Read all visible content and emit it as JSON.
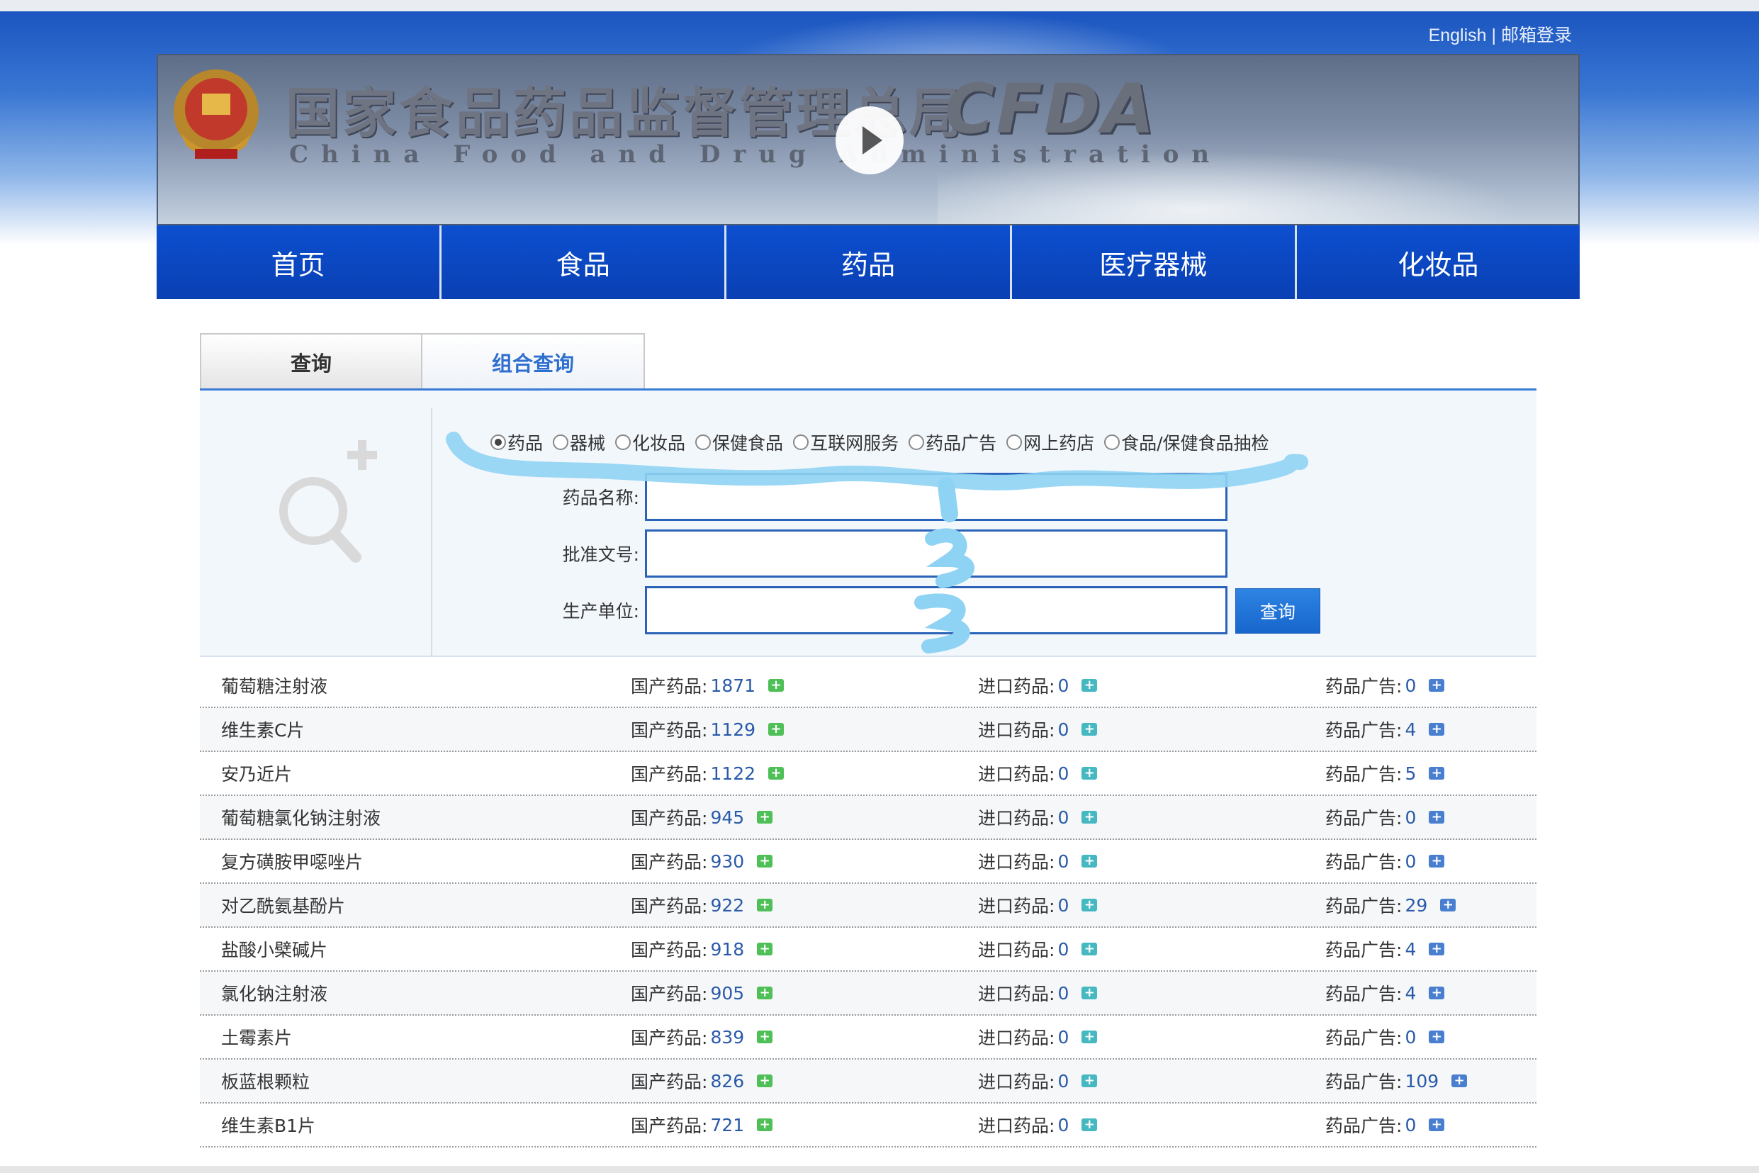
{
  "header": {
    "link_english": "English",
    "link_separator": "|",
    "link_mail": "邮箱登录",
    "banner_title_cn": "国家食品药品监督管理总局",
    "banner_title_en": "China Food and Drug Administration",
    "banner_logo": "CFDA"
  },
  "nav": {
    "items": [
      "首页",
      "食品",
      "药品",
      "医疗器械",
      "化妆品"
    ]
  },
  "tabs": {
    "query": "查询",
    "combined": "组合查询"
  },
  "search": {
    "categories": [
      "药品",
      "器械",
      "化妆品",
      "保健食品",
      "互联网服务",
      "药品广告",
      "网上药店",
      "食品/保健食品抽检"
    ],
    "selected_category": "药品",
    "field_name_label": "药品名称:",
    "field_approval_label": "批准文号:",
    "field_maker_label": "生产单位:",
    "field_name_value": "",
    "field_approval_value": "",
    "field_maker_value": "",
    "submit_label": "查询"
  },
  "results": {
    "domestic_label": "国产药品:",
    "import_label": "进口药品:",
    "ad_label": "药品广告:",
    "rows": [
      {
        "name": "葡萄糖注射液",
        "domestic": "1871",
        "imported": "0",
        "ads": "0"
      },
      {
        "name": "维生素C片",
        "domestic": "1129",
        "imported": "0",
        "ads": "4"
      },
      {
        "name": "安乃近片",
        "domestic": "1122",
        "imported": "0",
        "ads": "5"
      },
      {
        "name": "葡萄糖氯化钠注射液",
        "domestic": "945",
        "imported": "0",
        "ads": "0"
      },
      {
        "name": "复方磺胺甲噁唑片",
        "domestic": "930",
        "imported": "0",
        "ads": "0"
      },
      {
        "name": "对乙酰氨基酚片",
        "domestic": "922",
        "imported": "0",
        "ads": "29"
      },
      {
        "name": "盐酸小檗碱片",
        "domestic": "918",
        "imported": "0",
        "ads": "4"
      },
      {
        "name": "氯化钠注射液",
        "domestic": "905",
        "imported": "0",
        "ads": "4"
      },
      {
        "name": "土霉素片",
        "domestic": "839",
        "imported": "0",
        "ads": "0"
      },
      {
        "name": "板蓝根颗粒",
        "domestic": "826",
        "imported": "0",
        "ads": "109"
      },
      {
        "name": "维生素B1片",
        "domestic": "721",
        "imported": "0",
        "ads": "0"
      }
    ]
  },
  "colors": {
    "nav_blue": "#0b47c1",
    "accent_blue": "#2f6fcf",
    "scribble": "#8fd3f4"
  }
}
